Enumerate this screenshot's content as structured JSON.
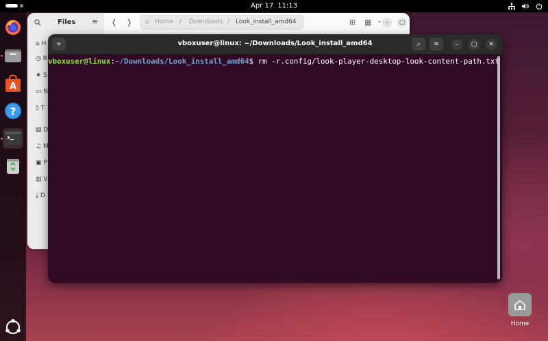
{
  "topbar": {
    "date": "Apr 17",
    "time": "11:13",
    "tray_icons": [
      "network-icon",
      "volume-icon",
      "power-icon"
    ]
  },
  "dock": {
    "items": [
      "firefox-icon",
      "files-icon",
      "software-icon",
      "help-icon",
      "terminal-icon",
      "trash-icon"
    ],
    "apps_grid": "show-apps-icon"
  },
  "files_window": {
    "title": "Files",
    "sidebar_items": [
      "H",
      "R",
      "S",
      "N",
      "T",
      "D",
      "M",
      "P",
      "V",
      "D"
    ],
    "breadcrumbs": [
      "Home",
      "Downloads",
      "Look_install_amd64"
    ],
    "min": "–",
    "max": "▢",
    "close": "✕"
  },
  "terminal": {
    "title": "vboxuser@linux: ~/Downloads/Look_install_amd64",
    "prompt_user": "vboxuser@linux",
    "prompt_sep": ":",
    "prompt_path": "~/Downloads/Look_install_amd64",
    "prompt_end": "$ ",
    "command": "rm -r.config/look-player-desktop-look-content-path.txt",
    "new_tab": "+",
    "search": "⌕",
    "menu": "≡",
    "min": "–",
    "max": "▢",
    "close": "✕"
  },
  "desktop": {
    "home_label": "Home"
  },
  "colors": {
    "terminal_bg": "#300a24",
    "prompt_user": "#8ae234",
    "prompt_path": "#729fcf",
    "ubuntu_orange": "#e95420"
  }
}
